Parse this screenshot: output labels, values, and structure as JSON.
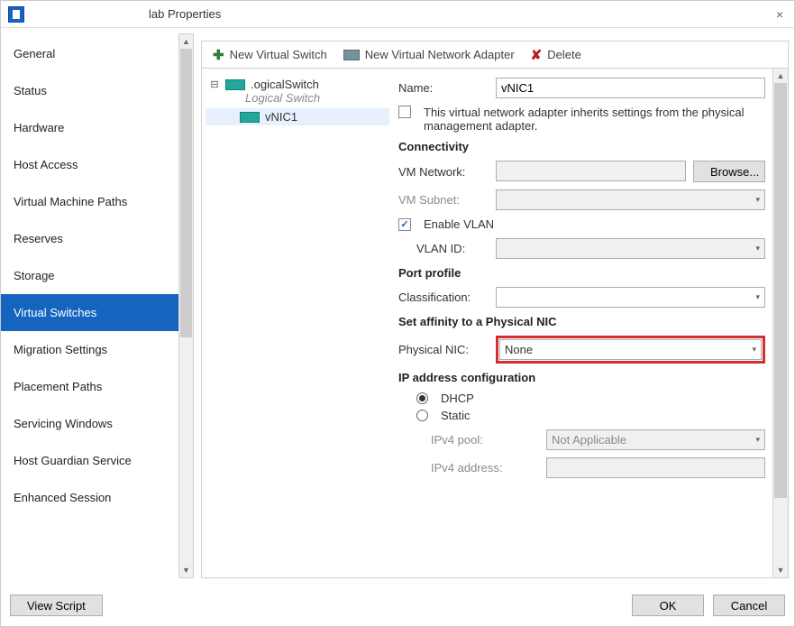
{
  "window": {
    "title": "lab Properties",
    "close_label": "×"
  },
  "sidebar": {
    "items": [
      {
        "label": "General"
      },
      {
        "label": "Status"
      },
      {
        "label": "Hardware"
      },
      {
        "label": "Host Access"
      },
      {
        "label": "Virtual Machine Paths"
      },
      {
        "label": "Reserves"
      },
      {
        "label": "Storage"
      },
      {
        "label": "Virtual Switches"
      },
      {
        "label": "Migration Settings"
      },
      {
        "label": "Placement Paths"
      },
      {
        "label": "Servicing Windows"
      },
      {
        "label": "Host Guardian Service"
      },
      {
        "label": "Enhanced Session"
      }
    ],
    "selected_index": 7
  },
  "toolbar": {
    "new_switch": "New Virtual Switch",
    "new_adapter": "New Virtual Network Adapter",
    "delete": "Delete"
  },
  "tree": {
    "switch_name": ".ogicalSwitch",
    "switch_type": "Logical Switch",
    "vnic_name": "vNIC1"
  },
  "form": {
    "name_label": "Name:",
    "name_value": "vNIC1",
    "inherit_label": "This virtual network adapter inherits settings from the physical management adapter.",
    "connectivity_header": "Connectivity",
    "vm_network_label": "VM Network:",
    "vm_network_value": "",
    "browse_label": "Browse...",
    "vm_subnet_label": "VM Subnet:",
    "vm_subnet_value": "",
    "enable_vlan_label": "Enable VLAN",
    "vlan_id_label": "VLAN ID:",
    "vlan_id_value": "",
    "port_profile_header": "Port profile",
    "classification_label": "Classification:",
    "classification_value": "",
    "affinity_header": "Set affinity to a Physical NIC",
    "physical_nic_label": "Physical NIC:",
    "physical_nic_value": "None",
    "ip_config_header": "IP address configuration",
    "dhcp_label": "DHCP",
    "static_label": "Static",
    "ipv4_pool_label": "IPv4 pool:",
    "ipv4_pool_value": "Not Applicable",
    "ipv4_address_label": "IPv4 address:",
    "ipv4_address_value": ""
  },
  "footer": {
    "view_script": "View Script",
    "ok": "OK",
    "cancel": "Cancel"
  }
}
